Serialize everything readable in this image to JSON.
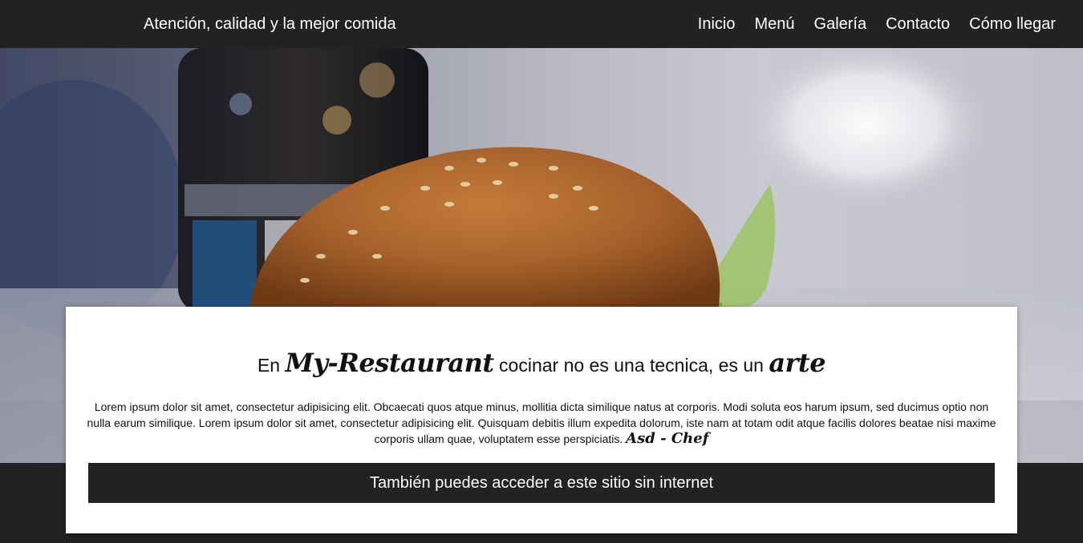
{
  "header": {
    "tagline": "Atención, calidad y la mejor comida",
    "nav": [
      "Inicio",
      "Menú",
      "Galería",
      "Contacto",
      "Cómo llegar"
    ]
  },
  "hero": {
    "image": "burger-photo"
  },
  "card": {
    "headline_prefix": "En",
    "brand": "My-Restaurant",
    "headline_middle": "cocinar no es una tecnica, es un",
    "headline_end": "arte",
    "body": "Lorem ipsum dolor sit amet, consectetur adipisicing elit. Obcaecati quos atque minus, mollitia dicta similique natus at corporis. Modi soluta eos harum ipsum, sed ducimus optio non nulla earum similique. Lorem ipsum dolor sit amet, consectetur adipisicing elit. Quisquam debitis illum expedita dolorum, iste nam at totam odit atque facilis dolores beatae nisi maxime corporis ullam quae, voluptatem esse perspiciatis.",
    "signature": "Asd - Chef",
    "offline_notice": "También puedes acceder a este sitio sin internet"
  },
  "colors": {
    "dark": "#222222",
    "card": "#ffffff",
    "text": "#111111"
  }
}
